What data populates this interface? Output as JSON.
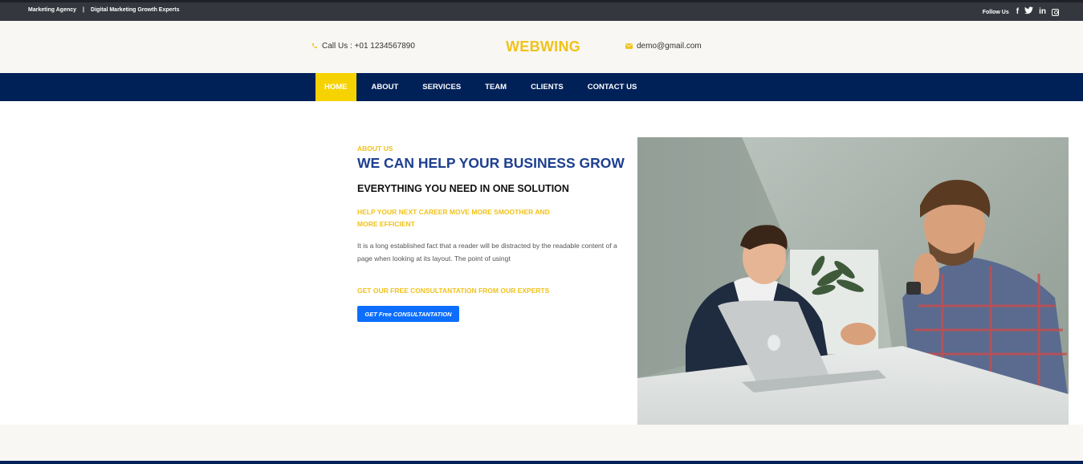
{
  "topbar": {
    "tagline_left": "Marketing Agency",
    "separator": "|",
    "tagline_right": "Digital Marketing Growth Experts",
    "follow_label": "Follow Us",
    "social_icons": [
      "facebook-icon",
      "twitter-icon",
      "linkedin-icon",
      "instagram-icon"
    ],
    "facebook_glyph": "f",
    "linkedin_glyph": "in"
  },
  "header": {
    "phone_label": "Call Us : +01 1234567890",
    "logo": "WEBWING",
    "email": "demo@gmail.com"
  },
  "nav": {
    "items": [
      {
        "label": "HOME",
        "active": true
      },
      {
        "label": "ABOUT",
        "active": false
      },
      {
        "label": "SERVICES",
        "active": false
      },
      {
        "label": "TEAM",
        "active": false
      },
      {
        "label": "CLIENTS",
        "active": false
      },
      {
        "label": "CONTACT US",
        "active": false
      }
    ]
  },
  "about": {
    "eyebrow": "ABOUT US",
    "headline": "WE CAN HELP YOUR BUSINESS GROW",
    "subhead": "EVERYTHING YOU NEED IN ONE SOLUTION",
    "lead": "HELP YOUR NEXT CAREER MOVE MORE SMOOTHER AND MORE EFFICIENT",
    "body": "It is a long established fact that a reader will be distracted by the readable content of a page when looking at its layout. The point of usingt",
    "consult_lead": "GET OUR FREE CONSULTANTATION FROM OUR EXPERTS",
    "cta_label": "GET Free CONSULTANTATION"
  },
  "colors": {
    "accent_yellow": "#f6d300",
    "nav_blue": "#002158",
    "headline_blue": "#1d3f8f",
    "button_blue": "#0d6efd",
    "topbar_dark": "#34373e"
  }
}
